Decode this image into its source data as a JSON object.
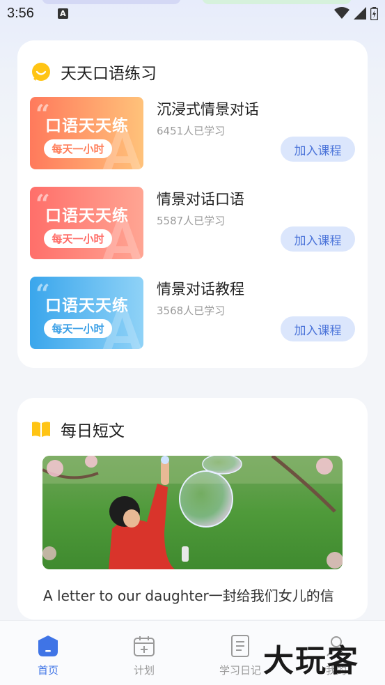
{
  "status_bar": {
    "time": "3:56",
    "notification_glyph": "A"
  },
  "courses_section": {
    "title": "天天口语练习",
    "icon": "smile-chat-icon",
    "items": [
      {
        "thumb_title": "口语天天练",
        "thumb_tag": "每天一小时",
        "name": "沉浸式情景对话",
        "count": "6451人已学习",
        "button": "加入课程",
        "thumb_color_start": "#ff7a5c",
        "thumb_color_end": "#ffc27a"
      },
      {
        "thumb_title": "口语天天练",
        "thumb_tag": "每天一小时",
        "name": "情景对话口语",
        "count": "5587人已学习",
        "button": "加入课程",
        "thumb_color_start": "#ff6f6a",
        "thumb_color_end": "#ffa593"
      },
      {
        "thumb_title": "口语天天练",
        "thumb_tag": "每天一小时",
        "name": "情景对话教程",
        "count": "3568人已学习",
        "button": "加入课程",
        "thumb_color_start": "#3aa6ec",
        "thumb_color_end": "#8fd2f7"
      }
    ]
  },
  "daily_section": {
    "title": "每日短文",
    "icon": "open-book-icon",
    "caption": "A letter to our daughter一封给我们女儿的信"
  },
  "bottom_nav": {
    "items": [
      {
        "label": "首页",
        "icon": "home-icon",
        "active": true
      },
      {
        "label": "计划",
        "icon": "calendar-icon",
        "active": false
      },
      {
        "label": "学习日记",
        "icon": "notebook-icon",
        "active": false
      },
      {
        "label": "我的",
        "icon": "profile-icon",
        "active": false
      }
    ]
  },
  "watermark": "大玩客",
  "colors": {
    "accent": "#3f74e6",
    "button_bg": "#dbe6fc",
    "button_text": "#4a73d9",
    "icon_yellow": "#ffc414"
  }
}
